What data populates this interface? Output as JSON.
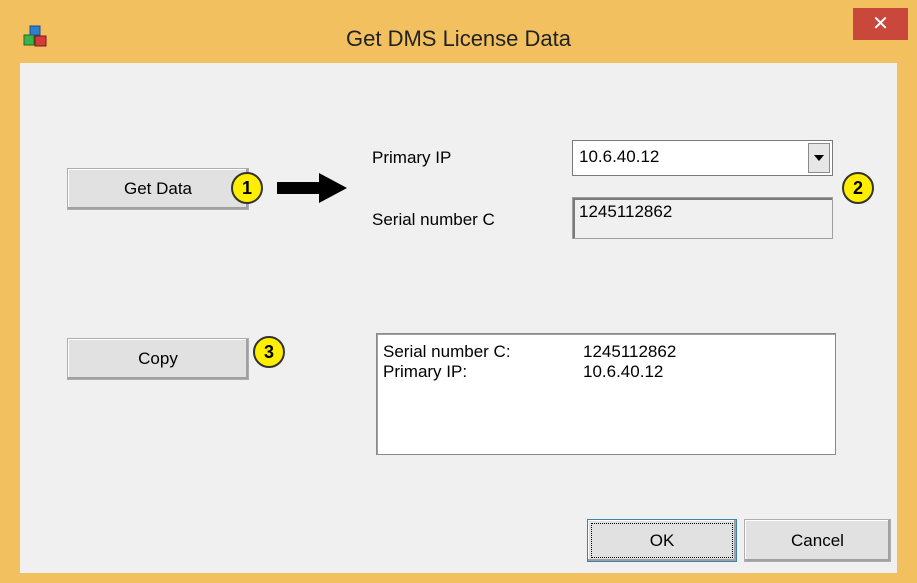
{
  "window": {
    "title": "Get DMS License Data",
    "close_label": "✕"
  },
  "buttons": {
    "get_data": "Get Data",
    "copy": "Copy",
    "ok": "OK",
    "cancel": "Cancel"
  },
  "fields": {
    "primary_ip_label": "Primary IP",
    "primary_ip_value": "10.6.40.12",
    "serial_label": "Serial number C",
    "serial_value": "1245112862"
  },
  "output": {
    "rows": [
      {
        "key": "Serial number C:",
        "value": "1245112862"
      },
      {
        "key": "Primary IP:",
        "value": "10.6.40.12"
      }
    ]
  },
  "badges": [
    "1",
    "2",
    "3"
  ],
  "colors": {
    "frame": "#f2c05f",
    "close": "#c9473b",
    "badge": "#ffee00"
  }
}
